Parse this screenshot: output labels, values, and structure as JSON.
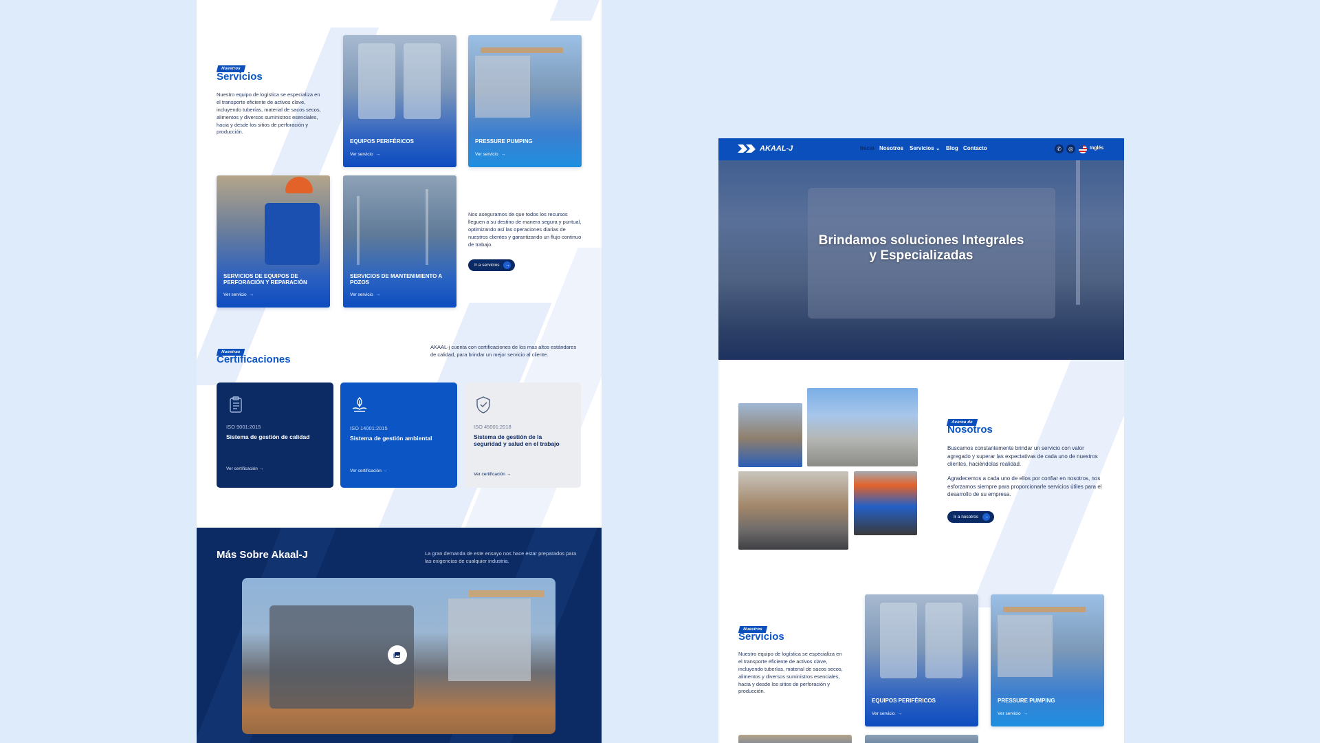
{
  "left_page": {
    "services": {
      "tag": "Nuestros",
      "title": "Servicios",
      "description": "Nuestro equipo de logística se especializa en el transporte eficiente de activos clave, incluyendo tuberías, material de sacos secos, alimentos y diversos suministros esenciales, hacia y desde los sitios de perforación y producción.",
      "cards": [
        {
          "title": "EQUIPOS PERIFÉRICOS",
          "link": "Ver servicio"
        },
        {
          "title": "PRESSURE PUMPING",
          "link": "Ver servicio"
        },
        {
          "title": "SERVICIOS DE EQUIPOS DE PERFORACIÓN Y REPARACIÓN",
          "link": "Ver servicio"
        },
        {
          "title": "SERVICIOS DE MANTENIMIENTO A POZOS",
          "link": "Ver servicio"
        }
      ],
      "side_text": "Nos aseguramos de que todos los recursos lleguen a su destino de manera segura y puntual, optimizando así las operaciones diarias de nuestros clientes y garantizando un flujo continuo de trabajo.",
      "button": "Ir a servicios"
    },
    "certifications": {
      "tag": "Nuestras",
      "title": "Certificaciones",
      "description": "AKAAL-j cuenta con certificaciones de los mas altos estándares de calidad, para brindar un mejor servicio al cliente.",
      "items": [
        {
          "code": "ISO 9001:2015",
          "name": "Sistema de gestión de calidad",
          "link": "Ver certificación",
          "icon": "clipboard-icon"
        },
        {
          "code": "ISO 14001:2015",
          "name": "Sistema de gestión ambiental",
          "link": "Ver certificación",
          "icon": "leaf-hand-icon"
        },
        {
          "code": "ISO 45001:2018",
          "name": "Sistema de gestión de la seguridad y salud en el trabajo",
          "link": "Ver certificación",
          "icon": "shield-check-icon"
        }
      ]
    },
    "more": {
      "title": "Más Sobre Akaal-J",
      "description": "La gran demanda de este ensayo nos hace estar preparados para las exigencias de cualquier industria.",
      "media_icon": "gallery-icon"
    }
  },
  "right_page": {
    "nav": {
      "logo": "AKAAL-J",
      "items": [
        "Inicio",
        "Nosotros",
        "Servicios",
        "Blog",
        "Contacto"
      ],
      "language": "Inglés",
      "icons": [
        "whatsapp-icon",
        "instagram-icon",
        "us-flag-icon"
      ]
    },
    "hero": {
      "title_line1": "Brindamos soluciones Integrales",
      "title_line2": "y Especializadas"
    },
    "about": {
      "tag": "Acerca de",
      "title": "Nosotros",
      "p1": "Buscamos constantemente brindar un servicio con valor agregado y superar las expectativas de cada uno de nuestros clientes, haciéndolas realidad.",
      "p2": "Agradecemos a cada uno de ellos por confiar en nosotros, nos esforzamos siempre para proporcionarle servicios útiles para el desarrollo de su empresa.",
      "button": "Ir a nosotros"
    },
    "services": {
      "tag": "Nuestros",
      "title": "Servicios",
      "description": "Nuestro equipo de logística se especializa en el transporte eficiente de activos clave, incluyendo tuberías, material de sacos secos, alimentos y diversos suministros esenciales, hacia y desde los sitios de perforación y producción.",
      "cards": [
        {
          "title": "EQUIPOS PERIFÉRICOS",
          "link": "Ver servicio"
        },
        {
          "title": "PRESSURE PUMPING",
          "link": "Ver servicio"
        }
      ]
    }
  },
  "colors": {
    "background": "#deebfb",
    "brand_blue": "#0b4fbd",
    "navy": "#0c2a63",
    "title_blue": "#0b56c6"
  }
}
